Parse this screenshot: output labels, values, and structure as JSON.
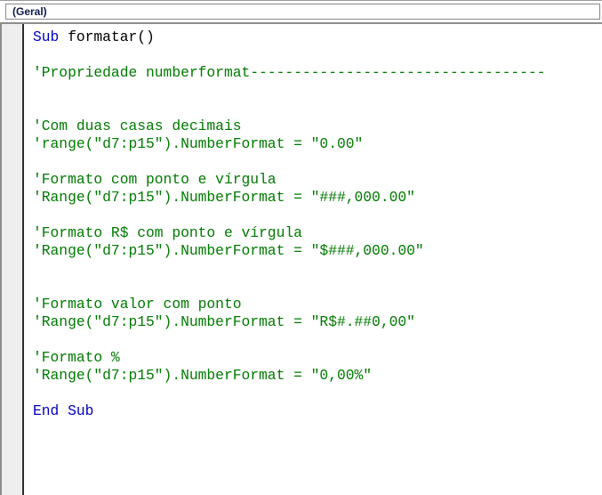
{
  "window": {
    "app_kind": "vba-code-editor"
  },
  "selector_bar": {
    "object_combo_value": "(Geral)",
    "procedure_combo_value": ""
  },
  "editor": {
    "language": "VBA",
    "colors": {
      "keyword": "#0000C0",
      "comment": "#007A00",
      "plain_text": "#000000",
      "background": "#FFFFFF",
      "margin_bar": "#EEEEEE"
    },
    "lines": [
      {
        "n": 1,
        "segments": [
          {
            "kind": "keyword",
            "text": "Sub "
          },
          {
            "kind": "plain",
            "text": "formatar()"
          }
        ]
      },
      {
        "n": 2,
        "segments": [
          {
            "kind": "plain",
            "text": ""
          }
        ]
      },
      {
        "n": 3,
        "segments": [
          {
            "kind": "comment",
            "text": "'Propriedade numberformat----------------------------------"
          }
        ]
      },
      {
        "n": 4,
        "segments": [
          {
            "kind": "plain",
            "text": ""
          }
        ]
      },
      {
        "n": 5,
        "segments": [
          {
            "kind": "plain",
            "text": ""
          }
        ]
      },
      {
        "n": 6,
        "segments": [
          {
            "kind": "comment",
            "text": "'Com duas casas decimais"
          }
        ]
      },
      {
        "n": 7,
        "segments": [
          {
            "kind": "comment",
            "text": "'range(\"d7:p15\").NumberFormat = \"0.00\""
          }
        ]
      },
      {
        "n": 8,
        "segments": [
          {
            "kind": "plain",
            "text": ""
          }
        ]
      },
      {
        "n": 9,
        "segments": [
          {
            "kind": "comment",
            "text": "'Formato com ponto e vírgula"
          }
        ]
      },
      {
        "n": 10,
        "segments": [
          {
            "kind": "comment",
            "text": "'Range(\"d7:p15\").NumberFormat = \"###,000.00\""
          }
        ]
      },
      {
        "n": 11,
        "segments": [
          {
            "kind": "plain",
            "text": ""
          }
        ]
      },
      {
        "n": 12,
        "segments": [
          {
            "kind": "comment",
            "text": "'Formato R$ com ponto e vírgula"
          }
        ]
      },
      {
        "n": 13,
        "segments": [
          {
            "kind": "comment",
            "text": "'Range(\"d7:p15\").NumberFormat = \"$###,000.00\""
          }
        ]
      },
      {
        "n": 14,
        "segments": [
          {
            "kind": "plain",
            "text": ""
          }
        ]
      },
      {
        "n": 15,
        "segments": [
          {
            "kind": "plain",
            "text": ""
          }
        ]
      },
      {
        "n": 16,
        "segments": [
          {
            "kind": "comment",
            "text": "'Formato valor com ponto"
          }
        ]
      },
      {
        "n": 17,
        "segments": [
          {
            "kind": "comment",
            "text": "'Range(\"d7:p15\").NumberFormat = \"R$#.##0,00\""
          }
        ]
      },
      {
        "n": 18,
        "segments": [
          {
            "kind": "plain",
            "text": ""
          }
        ]
      },
      {
        "n": 19,
        "segments": [
          {
            "kind": "comment",
            "text": "'Formato %"
          }
        ]
      },
      {
        "n": 20,
        "segments": [
          {
            "kind": "comment",
            "text": "'Range(\"d7:p15\").NumberFormat = \"0,00%\""
          }
        ]
      },
      {
        "n": 21,
        "segments": [
          {
            "kind": "plain",
            "text": ""
          }
        ]
      },
      {
        "n": 22,
        "segments": [
          {
            "kind": "keyword",
            "text": "End Sub"
          }
        ]
      }
    ]
  }
}
